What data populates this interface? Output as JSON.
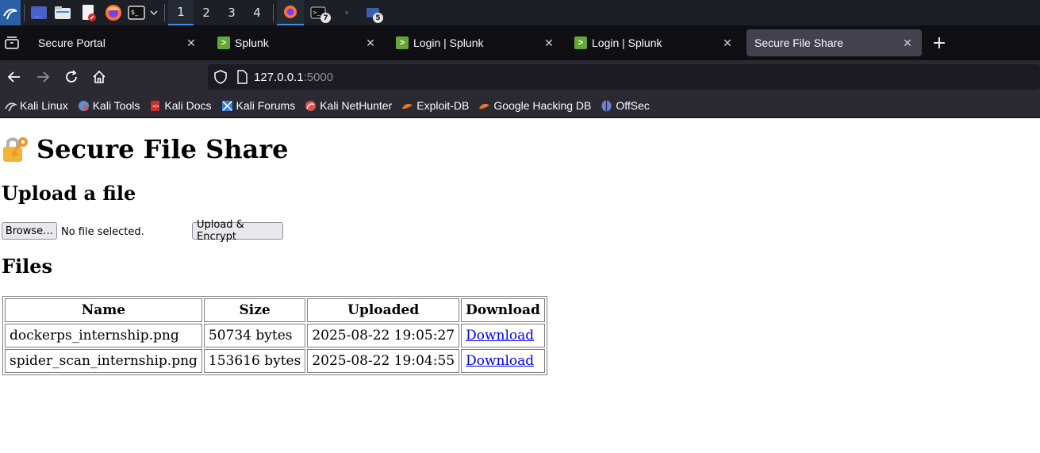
{
  "taskbar": {
    "workspaces": [
      "1",
      "2",
      "3",
      "4"
    ],
    "active_workspace": "1",
    "terminal_badge": "7",
    "app_badge": "5"
  },
  "browser": {
    "tabs": [
      {
        "title": "Secure Portal",
        "favicon": "none",
        "active": false
      },
      {
        "title": "Splunk",
        "favicon": "splunk-icon",
        "active": false
      },
      {
        "title": "Login | Splunk",
        "favicon": "splunk-icon",
        "active": false
      },
      {
        "title": "Login | Splunk",
        "favicon": "splunk-icon",
        "active": false
      },
      {
        "title": "Secure File Share",
        "favicon": "none",
        "active": true
      }
    ],
    "url_host": "127.0.0.1",
    "url_port": ":5000",
    "bookmarks": [
      {
        "label": "Kali Linux",
        "icon": "kali-dragon-icon",
        "color": "#d0d0d0"
      },
      {
        "label": "Kali Tools",
        "icon": "kali-tools-icon",
        "color": "#5b8fd6"
      },
      {
        "label": "Kali Docs",
        "icon": "kali-docs-icon",
        "color": "#c9302c"
      },
      {
        "label": "Kali Forums",
        "icon": "kali-forums-icon",
        "color": "#3b7dd8"
      },
      {
        "label": "Kali NetHunter",
        "icon": "nethunter-icon",
        "color": "#d9534f"
      },
      {
        "label": "Exploit-DB",
        "icon": "exploit-db-icon",
        "color": "#e8742f"
      },
      {
        "label": "Google Hacking DB",
        "icon": "ghdb-icon",
        "color": "#e8742f"
      },
      {
        "label": "OffSec",
        "icon": "offsec-icon",
        "color": "#6a7fd6"
      }
    ]
  },
  "page": {
    "title": "Secure File Share",
    "upload_heading": "Upload a file",
    "browse_label": "Browse…",
    "no_file_text": "No file selected.",
    "upload_button": "Upload & Encrypt",
    "files_heading": "Files",
    "table": {
      "headers": [
        "Name",
        "Size",
        "Uploaded",
        "Download"
      ],
      "rows": [
        {
          "name": "dockerps_internship.png",
          "size": "50734 bytes",
          "uploaded": "2025-08-22 19:05:27",
          "link": "Download"
        },
        {
          "name": "spider_scan_internship.png",
          "size": "153616 bytes",
          "uploaded": "2025-08-22 19:04:55",
          "link": "Download"
        }
      ]
    }
  }
}
